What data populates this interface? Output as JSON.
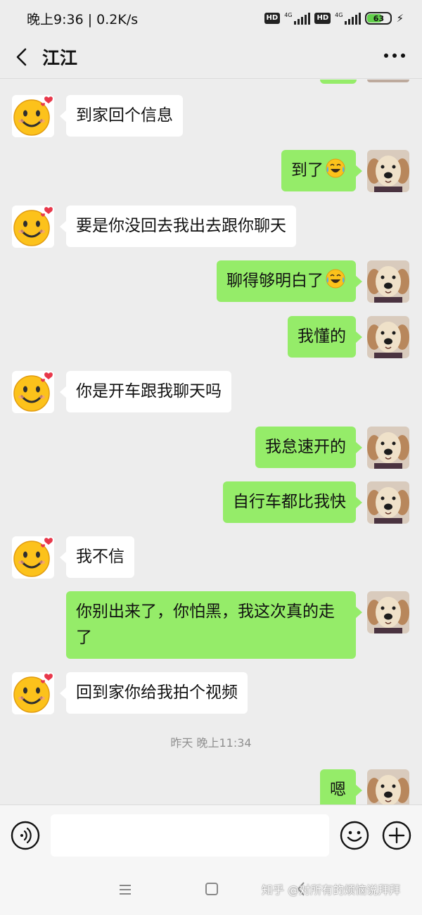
{
  "status_bar": {
    "time": "晚上9:36 | 0.2K/s",
    "hd_badge": "HD",
    "network_type": "4G",
    "battery_level": "63"
  },
  "header": {
    "title": "江江"
  },
  "messages": [
    {
      "side": "left",
      "text": "到家回个信息"
    },
    {
      "side": "right",
      "text": "到了",
      "emoji": "crying-laughing-emoji"
    },
    {
      "side": "left",
      "text": "要是你没回去我出去跟你聊天"
    },
    {
      "side": "right",
      "text": "聊得够明白了",
      "emoji": "crying-laughing-emoji"
    },
    {
      "side": "right",
      "text": "我懂的"
    },
    {
      "side": "left",
      "text": "你是开车跟我聊天吗"
    },
    {
      "side": "right",
      "text": "我怠速开的"
    },
    {
      "side": "right",
      "text": "自行车都比我快"
    },
    {
      "side": "left",
      "text": "我不信"
    },
    {
      "side": "right",
      "text": "你别出来了，你怕黑，我这次真的走了"
    },
    {
      "side": "left",
      "text": "回到家你给我拍个视频"
    },
    {
      "side": "right",
      "text": "嗯"
    }
  ],
  "timestamp": "昨天 晚上11:34",
  "input_bar": {
    "placeholder": ""
  },
  "watermark": "知乎 @对所有的烦恼说拜拜",
  "colors": {
    "self_bubble": "#95ec69",
    "other_bubble": "#ffffff",
    "background": "#ededed"
  },
  "icons": {
    "other_avatar": "smiley-face-avatar",
    "self_avatar": "puppy-photo-avatar",
    "voice": "voice-icon",
    "emoji": "emoji-icon",
    "plus": "plus-icon"
  }
}
